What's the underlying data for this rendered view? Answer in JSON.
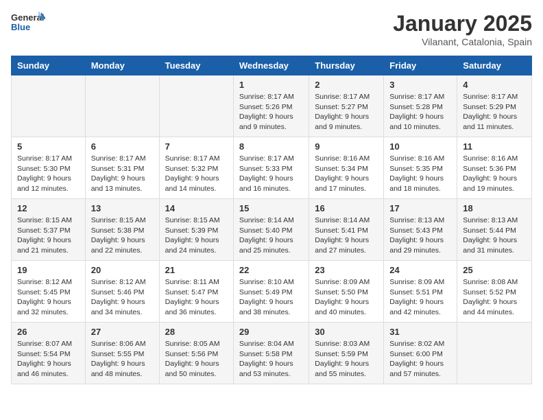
{
  "header": {
    "logo_line1": "General",
    "logo_line2": "Blue",
    "title": "January 2025",
    "subtitle": "Vilanant, Catalonia, Spain"
  },
  "days_of_week": [
    "Sunday",
    "Monday",
    "Tuesday",
    "Wednesday",
    "Thursday",
    "Friday",
    "Saturday"
  ],
  "weeks": [
    [
      {
        "day": "",
        "detail": ""
      },
      {
        "day": "",
        "detail": ""
      },
      {
        "day": "",
        "detail": ""
      },
      {
        "day": "1",
        "detail": "Sunrise: 8:17 AM\nSunset: 5:26 PM\nDaylight: 9 hours\nand 9 minutes."
      },
      {
        "day": "2",
        "detail": "Sunrise: 8:17 AM\nSunset: 5:27 PM\nDaylight: 9 hours\nand 9 minutes."
      },
      {
        "day": "3",
        "detail": "Sunrise: 8:17 AM\nSunset: 5:28 PM\nDaylight: 9 hours\nand 10 minutes."
      },
      {
        "day": "4",
        "detail": "Sunrise: 8:17 AM\nSunset: 5:29 PM\nDaylight: 9 hours\nand 11 minutes."
      }
    ],
    [
      {
        "day": "5",
        "detail": "Sunrise: 8:17 AM\nSunset: 5:30 PM\nDaylight: 9 hours\nand 12 minutes."
      },
      {
        "day": "6",
        "detail": "Sunrise: 8:17 AM\nSunset: 5:31 PM\nDaylight: 9 hours\nand 13 minutes."
      },
      {
        "day": "7",
        "detail": "Sunrise: 8:17 AM\nSunset: 5:32 PM\nDaylight: 9 hours\nand 14 minutes."
      },
      {
        "day": "8",
        "detail": "Sunrise: 8:17 AM\nSunset: 5:33 PM\nDaylight: 9 hours\nand 16 minutes."
      },
      {
        "day": "9",
        "detail": "Sunrise: 8:16 AM\nSunset: 5:34 PM\nDaylight: 9 hours\nand 17 minutes."
      },
      {
        "day": "10",
        "detail": "Sunrise: 8:16 AM\nSunset: 5:35 PM\nDaylight: 9 hours\nand 18 minutes."
      },
      {
        "day": "11",
        "detail": "Sunrise: 8:16 AM\nSunset: 5:36 PM\nDaylight: 9 hours\nand 19 minutes."
      }
    ],
    [
      {
        "day": "12",
        "detail": "Sunrise: 8:15 AM\nSunset: 5:37 PM\nDaylight: 9 hours\nand 21 minutes."
      },
      {
        "day": "13",
        "detail": "Sunrise: 8:15 AM\nSunset: 5:38 PM\nDaylight: 9 hours\nand 22 minutes."
      },
      {
        "day": "14",
        "detail": "Sunrise: 8:15 AM\nSunset: 5:39 PM\nDaylight: 9 hours\nand 24 minutes."
      },
      {
        "day": "15",
        "detail": "Sunrise: 8:14 AM\nSunset: 5:40 PM\nDaylight: 9 hours\nand 25 minutes."
      },
      {
        "day": "16",
        "detail": "Sunrise: 8:14 AM\nSunset: 5:41 PM\nDaylight: 9 hours\nand 27 minutes."
      },
      {
        "day": "17",
        "detail": "Sunrise: 8:13 AM\nSunset: 5:43 PM\nDaylight: 9 hours\nand 29 minutes."
      },
      {
        "day": "18",
        "detail": "Sunrise: 8:13 AM\nSunset: 5:44 PM\nDaylight: 9 hours\nand 31 minutes."
      }
    ],
    [
      {
        "day": "19",
        "detail": "Sunrise: 8:12 AM\nSunset: 5:45 PM\nDaylight: 9 hours\nand 32 minutes."
      },
      {
        "day": "20",
        "detail": "Sunrise: 8:12 AM\nSunset: 5:46 PM\nDaylight: 9 hours\nand 34 minutes."
      },
      {
        "day": "21",
        "detail": "Sunrise: 8:11 AM\nSunset: 5:47 PM\nDaylight: 9 hours\nand 36 minutes."
      },
      {
        "day": "22",
        "detail": "Sunrise: 8:10 AM\nSunset: 5:49 PM\nDaylight: 9 hours\nand 38 minutes."
      },
      {
        "day": "23",
        "detail": "Sunrise: 8:09 AM\nSunset: 5:50 PM\nDaylight: 9 hours\nand 40 minutes."
      },
      {
        "day": "24",
        "detail": "Sunrise: 8:09 AM\nSunset: 5:51 PM\nDaylight: 9 hours\nand 42 minutes."
      },
      {
        "day": "25",
        "detail": "Sunrise: 8:08 AM\nSunset: 5:52 PM\nDaylight: 9 hours\nand 44 minutes."
      }
    ],
    [
      {
        "day": "26",
        "detail": "Sunrise: 8:07 AM\nSunset: 5:54 PM\nDaylight: 9 hours\nand 46 minutes."
      },
      {
        "day": "27",
        "detail": "Sunrise: 8:06 AM\nSunset: 5:55 PM\nDaylight: 9 hours\nand 48 minutes."
      },
      {
        "day": "28",
        "detail": "Sunrise: 8:05 AM\nSunset: 5:56 PM\nDaylight: 9 hours\nand 50 minutes."
      },
      {
        "day": "29",
        "detail": "Sunrise: 8:04 AM\nSunset: 5:58 PM\nDaylight: 9 hours\nand 53 minutes."
      },
      {
        "day": "30",
        "detail": "Sunrise: 8:03 AM\nSunset: 5:59 PM\nDaylight: 9 hours\nand 55 minutes."
      },
      {
        "day": "31",
        "detail": "Sunrise: 8:02 AM\nSunset: 6:00 PM\nDaylight: 9 hours\nand 57 minutes."
      },
      {
        "day": "",
        "detail": ""
      }
    ]
  ]
}
